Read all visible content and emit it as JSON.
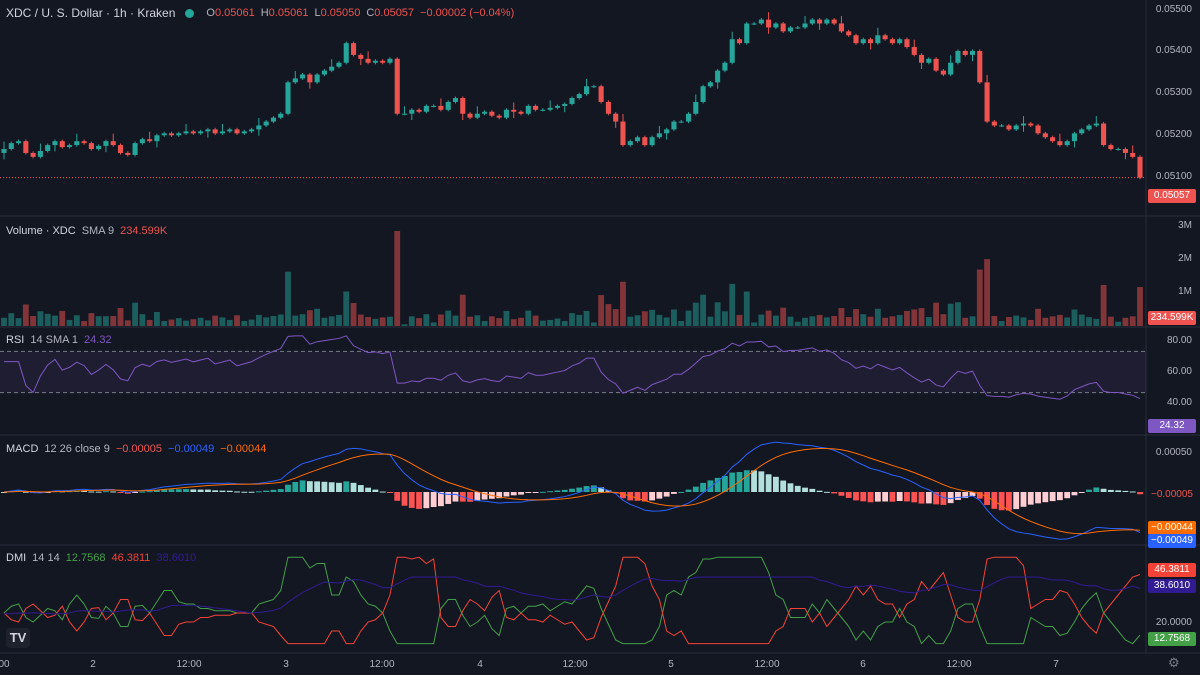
{
  "header": {
    "symbol": "XDC / U. S. Dollar · 1h · Kraken",
    "o_label": "O",
    "o_value": "0.05061",
    "h_label": "H",
    "h_value": "0.05061",
    "l_label": "L",
    "l_value": "0.05050",
    "c_label": "C",
    "c_value": "0.05057",
    "change": "−0.00002 (−0.04%)"
  },
  "volume_header": {
    "name": "Volume · XDC",
    "params": "SMA 9",
    "value": "234.599K"
  },
  "rsi_header": {
    "name": "RSI",
    "params": "14 SMA 1",
    "value": "24.32"
  },
  "macd_header": {
    "name": "MACD",
    "params": "12 26 close 9",
    "v1": "−0.00005",
    "v2": "−0.00049",
    "v3": "−0.00044"
  },
  "dmi_header": {
    "name": "DMI",
    "params": "14 14",
    "v1": "12.7568",
    "v2": "46.3811",
    "v3": "38.6010"
  },
  "price_axis": [
    "0.05500",
    "0.05400",
    "0.05300",
    "0.05200",
    "0.05100"
  ],
  "volume_axis": [
    "3M",
    "2M",
    "1M"
  ],
  "rsi_axis": [
    "80.00",
    "60.00",
    "40.00"
  ],
  "macd_axis": [
    "0.00050"
  ],
  "dmi_axis": [
    "20.0000"
  ],
  "labels": {
    "price": "0.05057",
    "volume": "234.599K",
    "rsi": "24.32",
    "macd_hist": "−0.00005",
    "macd_signal": "−0.00044",
    "macd_line": "−0.00049",
    "dmi_minus": "46.3811",
    "dmi_adx": "38.6010",
    "dmi_plus": "12.7568"
  },
  "x_axis": [
    "00",
    "2",
    "12:00",
    "3",
    "12:00",
    "4",
    "12:00",
    "5",
    "12:00",
    "6",
    "12:00",
    "7"
  ],
  "colors": {
    "up": "#26a69a",
    "down": "#ef5350",
    "rsi": "#7e57c2",
    "macd": "#2962ff",
    "signal": "#ff6d00",
    "plus_di": "#43a047",
    "minus_di": "#f44336",
    "adx": "#311b92"
  },
  "chart_data": {
    "type": "candlestick",
    "timeframe": "1h",
    "x_labels": [
      "00",
      "2",
      "12:00",
      "3",
      "12:00",
      "4",
      "12:00",
      "5",
      "12:00",
      "6",
      "12:00",
      "7"
    ],
    "price_ylim": [
      0.05,
      0.0551
    ],
    "close": [
      0.0513,
      0.05145,
      0.0515,
      0.0512,
      0.0511,
      0.05125,
      0.0514,
      0.0515,
      0.05135,
      0.0514,
      0.0515,
      0.05145,
      0.0513,
      0.05138,
      0.0515,
      0.0514,
      0.0512,
      0.05115,
      0.05145,
      0.05155,
      0.0515,
      0.05165,
      0.0517,
      0.05165,
      0.0517,
      0.05175,
      0.0517,
      0.05175,
      0.0518,
      0.0517,
      0.05175,
      0.0518,
      0.0517,
      0.05175,
      0.0518,
      0.0519,
      0.052,
      0.0521,
      0.0522,
      0.053,
      0.0531,
      0.0532,
      0.053,
      0.0532,
      0.0533,
      0.0534,
      0.0535,
      0.054,
      0.0537,
      0.0536,
      0.0535,
      0.05355,
      0.0535,
      0.0536,
      0.0522,
      0.0522,
      0.0523,
      0.05225,
      0.0524,
      0.0524,
      0.0523,
      0.0525,
      0.0526,
      0.0522,
      0.0521,
      0.0522,
      0.05225,
      0.05215,
      0.0521,
      0.0523,
      0.05225,
      0.0522,
      0.0524,
      0.0523,
      0.0523,
      0.05235,
      0.0524,
      0.05245,
      0.0526,
      0.0527,
      0.0529,
      0.0529,
      0.0525,
      0.0522,
      0.052,
      0.0514,
      0.0515,
      0.0516,
      0.0514,
      0.0516,
      0.0517,
      0.0518,
      0.052,
      0.052,
      0.0522,
      0.0525,
      0.0529,
      0.053,
      0.0533,
      0.0535,
      0.0541,
      0.054,
      0.0545,
      0.0545,
      0.0546,
      0.0544,
      0.0545,
      0.0543,
      0.0544,
      0.0544,
      0.0545,
      0.0546,
      0.0545,
      0.0546,
      0.0545,
      0.0543,
      0.0542,
      0.054,
      0.0541,
      0.054,
      0.0542,
      0.0541,
      0.054,
      0.0541,
      0.0539,
      0.0537,
      0.0535,
      0.0536,
      0.0533,
      0.0532,
      0.0535,
      0.0538,
      0.0537,
      0.0538,
      0.053,
      0.052,
      0.0519,
      0.0519,
      0.0518,
      0.0519,
      0.05195,
      0.0519,
      0.0517,
      0.0516,
      0.0515,
      0.0514,
      0.0515,
      0.0517,
      0.0518,
      0.0519,
      0.05195,
      0.0514,
      0.0513,
      0.0513,
      0.0512,
      0.0511,
      0.05057
    ]
  }
}
